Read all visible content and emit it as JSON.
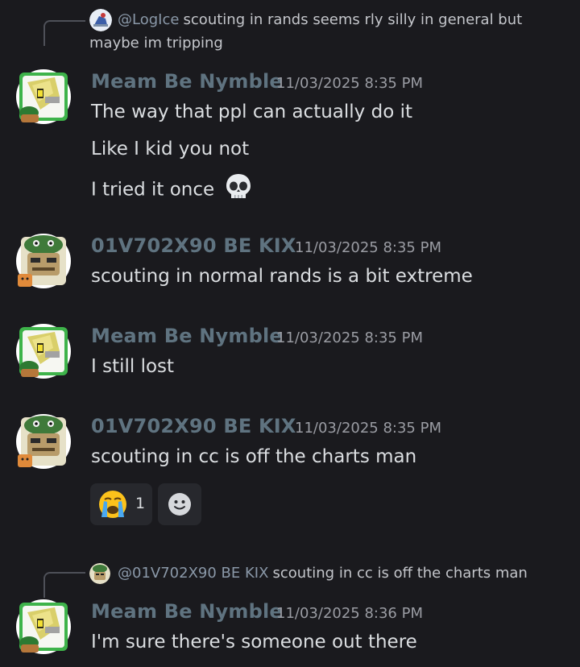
{
  "colors": {
    "background": "#1a1a1e",
    "username": "#5f7380",
    "timestamp": "#9a9ca3",
    "text": "#dbdee1",
    "mention": "#8a98a8"
  },
  "messages": [
    {
      "reply": {
        "mention": "@LogIce",
        "text_line1": "scouting in rands seems rly silly in general but",
        "text_line2": "maybe im tripping"
      },
      "author": "Meam Be Nymble",
      "timestamp": "11/03/2025 8:35 PM",
      "lines": [
        "The way that ppl can actually do it",
        "Like I kid you not",
        "I tried it once"
      ],
      "trailing_emoji": "skull-emoji"
    },
    {
      "author": "01V702X90 BE KIX",
      "timestamp": "11/03/2025 8:35 PM",
      "lines": [
        "scouting in normal rands is a bit extreme"
      ]
    },
    {
      "author": "Meam Be Nymble",
      "timestamp": "11/03/2025 8:35 PM",
      "lines": [
        "I still lost"
      ]
    },
    {
      "author": "01V702X90 BE KIX",
      "timestamp": "11/03/2025 8:35 PM",
      "lines": [
        "scouting in cc is off the charts man"
      ],
      "reactions": [
        {
          "emoji": "loudly-crying-face-emoji",
          "count": "1"
        },
        {
          "emoji": "add-reaction-icon"
        }
      ]
    },
    {
      "reply": {
        "mention": "@01V702X90 BE KIX",
        "text_line1": "scouting in cc is off the charts man"
      },
      "author": "Meam Be Nymble",
      "timestamp": "11/03/2025 8:36 PM",
      "lines": [
        "I'm sure there's someone out there"
      ]
    }
  ]
}
